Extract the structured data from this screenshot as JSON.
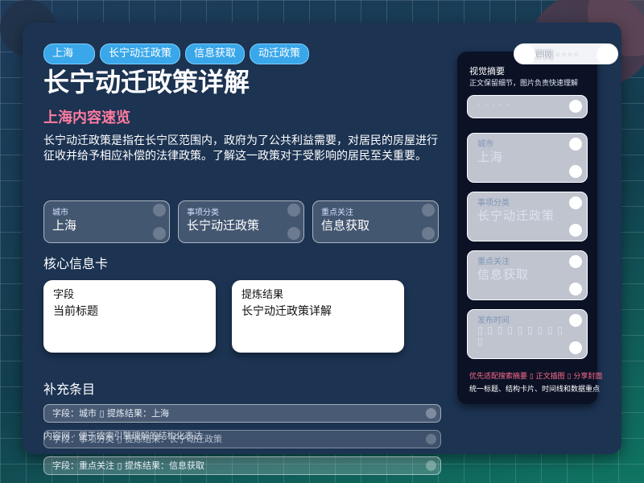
{
  "chips": [
    "上海",
    "长宁动迁政策",
    "信息获取",
    "动迁政策"
  ],
  "badge": "评网 · · · ·",
  "title": "长宁动迁政策详解",
  "subtitle": "上海内容速览",
  "intro": "长宁动迁政策是指在长宁区范围内，政府为了公共利益需要，对居民的房屋进行征收并给予相应补偿的法律政策。了解这一政策对于受影响的居民至关重要。",
  "meta": [
    {
      "label": "城市",
      "value": "上海"
    },
    {
      "label": "事项分类",
      "value": "长宁动迁政策"
    },
    {
      "label": "重点关注",
      "value": "信息获取"
    }
  ],
  "core_heading": "核心信息卡",
  "core_cards": [
    {
      "label": "字段",
      "value": "当前标题"
    },
    {
      "label": "提炼结果",
      "value": "长宁动迁政策详解"
    }
  ],
  "extra_heading": "补充条目",
  "extra_rows": [
    "字段：城市  ▯  提炼结果：上海",
    "字段：事项分类  ▯  提炼结果：长宁动迁政策",
    "字段：重点关注  ▯  提炼结果：信息获取"
  ],
  "extra_row_behind": "内容网 · 便于搜索引擎理解的结构化表达",
  "sidebar": {
    "title": "视觉摘要",
    "subtitle": "正文保留细节，图片负责快速理解",
    "cards": [
      {
        "label": "",
        "value": "· · · · ·"
      },
      {
        "label": "城市",
        "value": "上海"
      },
      {
        "label": "事项分类",
        "value": "长宁动迁政策"
      },
      {
        "label": "重点关注",
        "value": "信息获取"
      },
      {
        "label": "发布时间",
        "value": "▯ ▯ ▯ ▯ ▯ ▯ ▯ ▯ ▯ ▯"
      }
    ],
    "footer_pink": "优先适配搜索摘要  ▯  正文插图  ▯  分享封面",
    "footer_white": "统一标题、结构卡片、时间线和数据重点"
  }
}
